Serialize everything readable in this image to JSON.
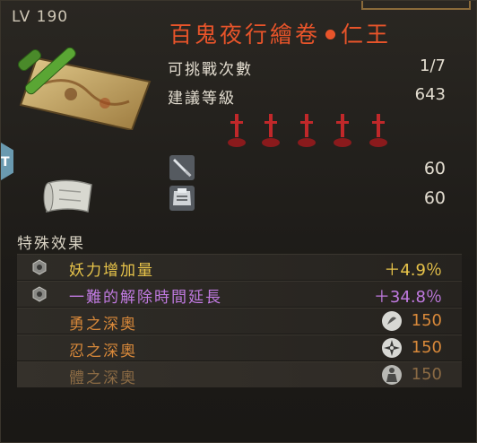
{
  "header": {
    "level_label": "LV 190"
  },
  "mission": {
    "title_part1": "百鬼夜行繪卷",
    "title_part2": "仁王"
  },
  "info": [
    {
      "label": "可挑戰次數",
      "value": "1/7"
    },
    {
      "label": "建議等級",
      "value": "643"
    }
  ],
  "difficulty": {
    "icon": "sword-stuck-in-ground-icon",
    "count": 5,
    "color": "#c0282a"
  },
  "stats": [
    {
      "icon": "sword-attack-icon",
      "value": "60"
    },
    {
      "icon": "armor-defense-icon",
      "value": "60"
    }
  ],
  "special": {
    "heading": "特殊效果",
    "effects": [
      {
        "label": "妖力增加量",
        "value": "＋4.9％",
        "color": "#e8c44a",
        "icon": "soul-core-icon"
      },
      {
        "label": "一難的解除時間延長",
        "value": "＋34.8％",
        "color": "#c07ae0",
        "icon": "soul-core-icon"
      },
      {
        "label": "勇之深奧",
        "value": "150",
        "color": "#d9893a",
        "icon": "strong-stance-icon"
      },
      {
        "label": "忍之深奧",
        "value": "150",
        "color": "#d9893a",
        "icon": "shuriken-icon"
      },
      {
        "label": "體之深奧",
        "value": "150",
        "color": "#8a6a44",
        "icon": "body-stance-icon"
      }
    ]
  },
  "colors": {
    "title": "#e8542a",
    "text": "#e3ddd0",
    "accent_gold": "#e8c44a",
    "accent_purple": "#c07ae0",
    "accent_orange": "#d9893a"
  }
}
